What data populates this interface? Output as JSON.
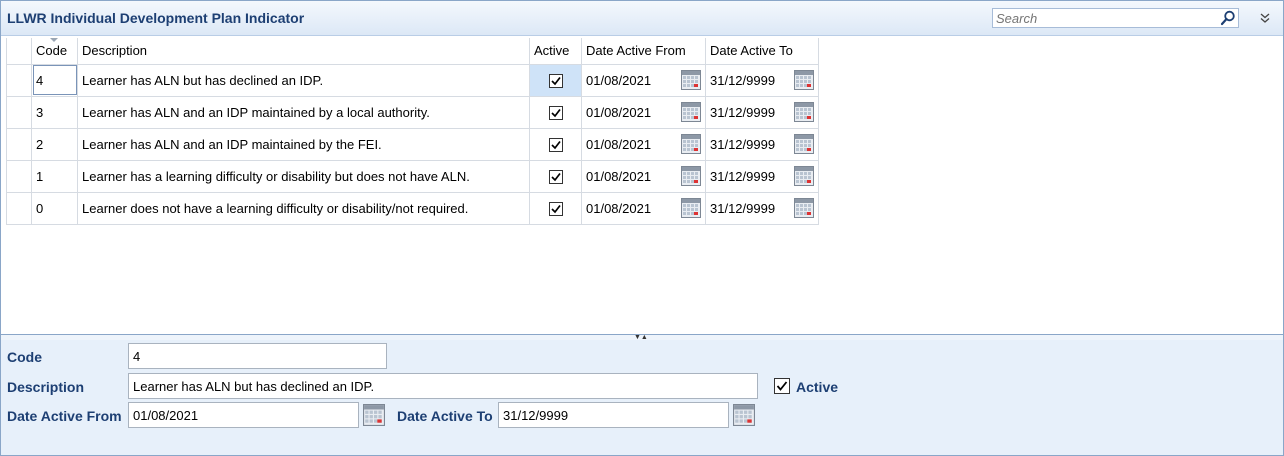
{
  "header": {
    "title": "LLWR Individual Development Plan Indicator",
    "search_placeholder": "Search"
  },
  "grid": {
    "columns": {
      "code": "Code",
      "description": "Description",
      "active": "Active",
      "date_from": "Date Active From",
      "date_to": "Date Active To"
    },
    "rows": [
      {
        "code": "4",
        "description": "Learner has ALN but has declined an IDP.",
        "active": true,
        "date_from": "01/08/2021",
        "date_to": "31/12/9999"
      },
      {
        "code": "3",
        "description": "Learner has ALN and an IDP maintained by a local authority.",
        "active": true,
        "date_from": "01/08/2021",
        "date_to": "31/12/9999"
      },
      {
        "code": "2",
        "description": "Learner has ALN and an IDP maintained by the FEI.",
        "active": true,
        "date_from": "01/08/2021",
        "date_to": "31/12/9999"
      },
      {
        "code": "1",
        "description": "Learner has a learning difficulty or disability but does not have ALN.",
        "active": true,
        "date_from": "01/08/2021",
        "date_to": "31/12/9999"
      },
      {
        "code": "0",
        "description": "Learner does not have a learning difficulty or disability/not required.",
        "active": true,
        "date_from": "01/08/2021",
        "date_to": "31/12/9999"
      }
    ]
  },
  "form": {
    "code_label": "Code",
    "code_value": "4",
    "description_label": "Description",
    "description_value": "Learner has ALN but has declined an IDP.",
    "active_label": "Active",
    "active_checked": true,
    "date_from_label": "Date Active From",
    "date_from_value": "01/08/2021",
    "date_to_label": "Date Active To",
    "date_to_value": "31/12/9999"
  },
  "icons": {
    "search": "search-icon",
    "collapse": "double-chevron-down-icon",
    "calendar": "calendar-icon",
    "checkbox": "checkmark-icon"
  },
  "colors": {
    "title": "#1d3f73",
    "selected_cell": "#cfe3f8",
    "form_background": "#e7f0fa"
  }
}
